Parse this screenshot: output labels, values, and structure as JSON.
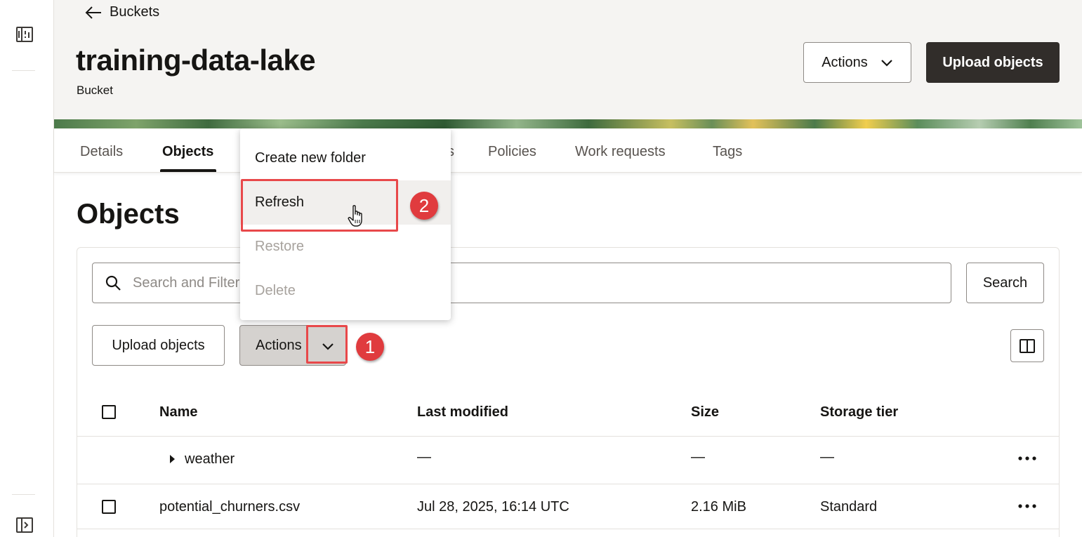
{
  "header": {
    "back_label": "Buckets",
    "title": "training-data-lake",
    "subtitle": "Bucket",
    "actions_label": "Actions",
    "upload_label": "Upload objects"
  },
  "tabs": [
    {
      "label": "Details"
    },
    {
      "label": "Objects"
    },
    {
      "label": "s"
    },
    {
      "label": "Policies"
    },
    {
      "label": "Work requests"
    },
    {
      "label": "Tags"
    }
  ],
  "section": {
    "title": "Objects"
  },
  "search": {
    "placeholder": "Search and Filter",
    "button_label": "Search"
  },
  "toolbar": {
    "upload_label": "Upload objects",
    "actions_label": "Actions"
  },
  "menu": {
    "items": [
      {
        "label": "Create new folder",
        "enabled": true
      },
      {
        "label": "Refresh",
        "enabled": true
      },
      {
        "label": "Restore",
        "enabled": false
      },
      {
        "label": "Delete",
        "enabled": false
      }
    ]
  },
  "table": {
    "columns": [
      "Name",
      "Last modified",
      "Size",
      "Storage tier"
    ],
    "rows": [
      {
        "name": "weather",
        "modified": "—",
        "size": "—",
        "tier": "—"
      },
      {
        "name": "potential_churners.csv",
        "modified": "Jul 28, 2025, 16:14 UTC",
        "size": "2.16 MiB",
        "tier": "Standard"
      }
    ]
  },
  "annotations": {
    "step1": "1",
    "step2": "2",
    "color": "#e8484a"
  },
  "icons": {
    "rail_top": "panel-icon",
    "rail_bottom": "expand-sidebar-icon",
    "search": "search-icon",
    "columns": "columns-icon",
    "more": "more-icon"
  }
}
